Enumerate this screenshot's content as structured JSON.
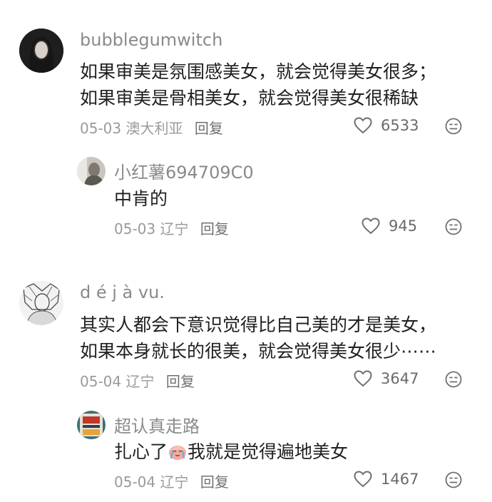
{
  "comments": [
    {
      "username": "bubblegumwitch",
      "lines": [
        "如果审美是氛围感美女，就会觉得美女很多；",
        "如果审美是骨相美女，就会觉得美女很稀缺"
      ],
      "date": "05-03",
      "location": "澳大利亚",
      "reply_label": "回复",
      "likes": "6533",
      "replies": [
        {
          "username": "小红薯694709C0",
          "text": "中肯的",
          "date": "05-03",
          "location": "辽宁",
          "reply_label": "回复",
          "likes": "945"
        }
      ]
    },
    {
      "username": "d é j à  vu.",
      "lines": [
        "其实人都会下意识觉得比自己美的才是美女，",
        "如果本身就长的很美，就会觉得美女很少⋯⋯"
      ],
      "date": "05-04",
      "location": "辽宁",
      "reply_label": "回复",
      "likes": "3647",
      "replies": [
        {
          "username": "超认真走路",
          "text_before": "扎心了",
          "emoji": "crying-face-emoji",
          "text_after": "我就是觉得遍地美女",
          "date": "05-04",
          "location": "辽宁",
          "reply_label": "回复",
          "likes": "1467"
        }
      ]
    }
  ]
}
